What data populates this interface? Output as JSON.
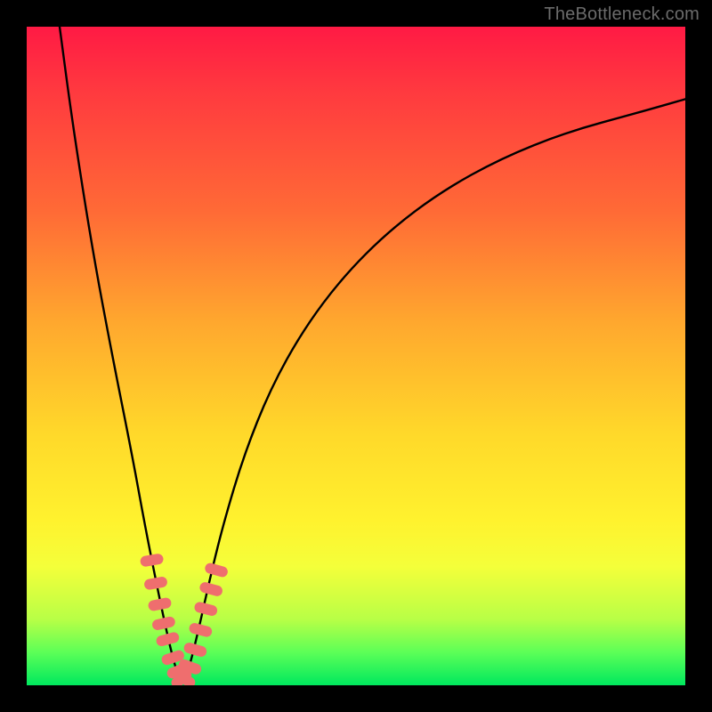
{
  "watermark": "TheBottleneck.com",
  "chart_data": {
    "type": "line",
    "title": "",
    "xlabel": "",
    "ylabel": "",
    "xlim": [
      0,
      100
    ],
    "ylim": [
      0,
      100
    ],
    "background": {
      "gradient_direction": "vertical",
      "stops": [
        {
          "pos": 0.0,
          "color": "#ff1a44"
        },
        {
          "pos": 0.28,
          "color": "#ff6a36"
        },
        {
          "pos": 0.62,
          "color": "#ffd92a"
        },
        {
          "pos": 0.9,
          "color": "#b8ff46"
        },
        {
          "pos": 1.0,
          "color": "#00e85e"
        }
      ]
    },
    "series": [
      {
        "name": "bottleneck-curve",
        "color": "#000000",
        "x": [
          5,
          7,
          10,
          13,
          16,
          18,
          20,
          21.5,
          22.5,
          23.5,
          24.5,
          26,
          28,
          30,
          33,
          37,
          42,
          48,
          55,
          63,
          72,
          82,
          93,
          100
        ],
        "y": [
          100,
          85,
          66,
          50,
          35,
          24,
          14,
          7,
          3,
          0,
          2,
          8,
          17,
          25,
          35,
          45,
          54,
          62,
          69,
          75,
          80,
          84,
          87,
          89
        ]
      }
    ],
    "markers": {
      "name": "highlighted-points",
      "color": "#ef6e6e",
      "shape": "rounded-bar",
      "points": [
        {
          "x": 19.0,
          "y": 19.0
        },
        {
          "x": 19.6,
          "y": 15.5
        },
        {
          "x": 20.2,
          "y": 12.3
        },
        {
          "x": 20.8,
          "y": 9.4
        },
        {
          "x": 21.4,
          "y": 7.0
        },
        {
          "x": 22.2,
          "y": 4.2
        },
        {
          "x": 23.0,
          "y": 2.2
        },
        {
          "x": 23.5,
          "y": 1.0
        },
        {
          "x": 24.0,
          "y": 1.0
        },
        {
          "x": 24.8,
          "y": 2.8
        },
        {
          "x": 25.6,
          "y": 5.4
        },
        {
          "x": 26.4,
          "y": 8.4
        },
        {
          "x": 27.2,
          "y": 11.6
        },
        {
          "x": 28.0,
          "y": 14.6
        },
        {
          "x": 28.8,
          "y": 17.5
        }
      ]
    }
  }
}
